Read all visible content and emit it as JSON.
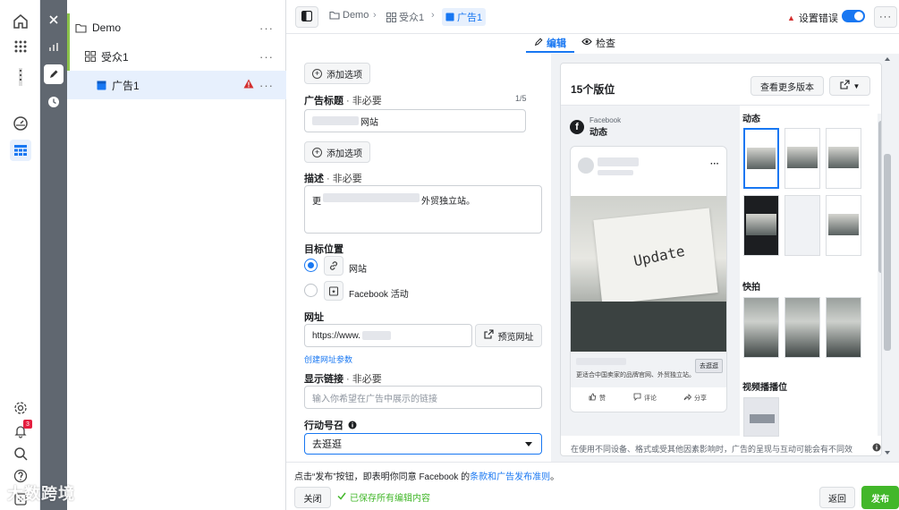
{
  "topbar": {
    "breadcrumbs": [
      "Demo",
      "受众1",
      "广告1"
    ],
    "error_label": "设置错误",
    "more": "···"
  },
  "tabs": [
    {
      "label": "编辑",
      "active": true
    },
    {
      "label": "检查",
      "active": false
    }
  ],
  "tree": {
    "campaign": "Demo",
    "adset": "受众1",
    "ad": "广告1",
    "more": "···"
  },
  "form": {
    "add_option": "添加选项",
    "headline_label": "广告标题",
    "headline_optional": " · 非必要",
    "headline_counter": "1/5",
    "headline_value": "网站",
    "description_label": "描述",
    "description_optional": " · 非必要",
    "description_prefix": "更",
    "description_suffix": "外贸独立站。",
    "destination_label": "目标位置",
    "destination_options": [
      "网站",
      "Facebook 活动"
    ],
    "url_label": "网址",
    "url_value": "https://www.",
    "preview_url_button": "预览网址",
    "build_url_params": "创建网址参数",
    "display_link_label": "显示链接",
    "display_link_optional": " · 非必要",
    "display_link_placeholder": "输入你希望在广告中展示的链接",
    "cta_label": "行动号召",
    "cta_value": "去逛逛"
  },
  "preview": {
    "title": "15个版位",
    "see_more_button": "查看更多版本",
    "fb_brand": "Facebook",
    "fb_feed": "动态",
    "post_more": "···",
    "image_text": "Update",
    "post_caption": "更适合中国卖家的品牌官网、外贸独立站。",
    "post_cta": "去逛逛",
    "actions": [
      "赞",
      "评论",
      "分享"
    ],
    "section_feed": "动态",
    "section_stories": "快拍",
    "section_video": "视频播播位",
    "note": "在使用不同设备、格式或受其他因素影响时，广告的呈现与互动可能会有不同效果。"
  },
  "bottombar": {
    "terms_prefix": "点击“发布”按钮，即表明你同意 Facebook 的",
    "terms_link": "条款和广告发布准则",
    "terms_suffix": "。",
    "close_button": "关闭",
    "saved_text": "已保存所有编辑内容",
    "back_button": "返回",
    "publish_button": "发布"
  },
  "rail": {
    "notification_count": "3"
  },
  "watermark": "大数跨境",
  "colors": {
    "accent": "#1877f2",
    "publish": "#42b72a",
    "error": "#d32f2f"
  }
}
